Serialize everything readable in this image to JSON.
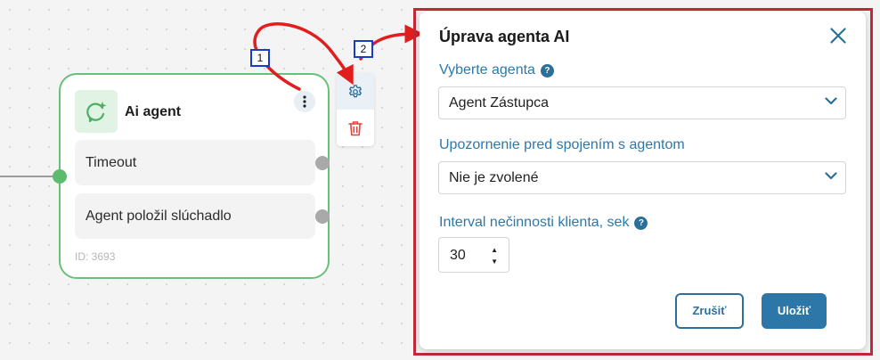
{
  "node": {
    "title": "Ai agent",
    "outlets": [
      {
        "label": "Timeout"
      },
      {
        "label": "Agent položil slúchadlo"
      }
    ],
    "id_label": "ID: 3693",
    "icon": "ai-agent-icon",
    "menu_icon": "more-vertical-icon"
  },
  "toolbar": {
    "settings_icon": "gear-icon",
    "delete_icon": "trash-icon"
  },
  "annotations": {
    "badge_1": "1",
    "badge_2": "2"
  },
  "panel": {
    "title": "Úprava agenta AI",
    "close_icon": "close-icon",
    "fields": {
      "agent": {
        "label": "Vyberte agenta",
        "help": "?",
        "value": "Agent Zástupca"
      },
      "notify": {
        "label": "Upozornenie pred spojením s agentom",
        "value": "Nie je zvolené"
      },
      "interval": {
        "label": "Interval nečinnosti klienta, sek",
        "help": "?",
        "value": "30"
      }
    },
    "buttons": {
      "cancel": "Zrušiť",
      "save": "Uložiť"
    }
  },
  "colors": {
    "node_border": "#69c07a",
    "accent": "#2c77a7",
    "label": "#2e78a8",
    "highlight": "#c32838",
    "badge_border": "#1a3cc9",
    "delete": "#e0453f"
  }
}
